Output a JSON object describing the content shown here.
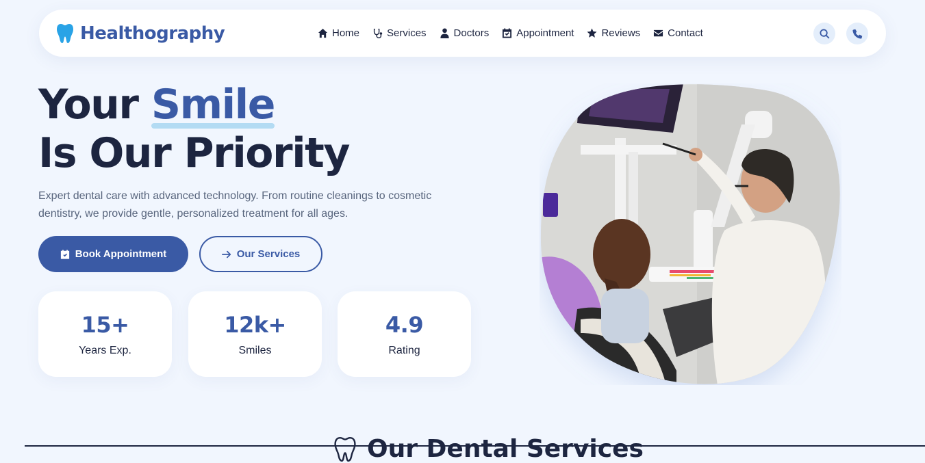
{
  "brand": {
    "name": "Healthography",
    "logo_icon": "tooth-icon",
    "logo_color": "#29a3e6"
  },
  "nav": {
    "items": [
      {
        "label": "Home",
        "icon": "home-icon"
      },
      {
        "label": "Services",
        "icon": "stethoscope-icon"
      },
      {
        "label": "Doctors",
        "icon": "doctor-icon"
      },
      {
        "label": "Appointment",
        "icon": "calendar-check-icon"
      },
      {
        "label": "Reviews",
        "icon": "star-icon"
      },
      {
        "label": "Contact",
        "icon": "envelope-icon"
      }
    ],
    "actions": [
      {
        "icon": "search-icon"
      },
      {
        "icon": "phone-icon"
      }
    ]
  },
  "hero": {
    "title_prefix": "Your",
    "title_accent": "Smile",
    "title_line2": "Is Our Priority",
    "description": "Expert dental care with advanced technology. From routine cleanings to cosmetic dentistry, we provide gentle, personalized treatment for all ages.",
    "primary_button": "Book Appointment",
    "secondary_button": "Our Services",
    "image_alt": "dentist-consulting-patient-photo"
  },
  "stats": [
    {
      "value": "15+",
      "label": "Years Exp."
    },
    {
      "value": "12k+",
      "label": "Smiles"
    },
    {
      "value": "4.9",
      "label": "Rating"
    }
  ],
  "next_section": {
    "heading": "Our Dental Services"
  },
  "colors": {
    "primary": "#3a5aa5",
    "dark": "#1d2540",
    "muted": "#58657d",
    "background": "#f1f6fe",
    "accent_underline": "#b3dbf3"
  }
}
